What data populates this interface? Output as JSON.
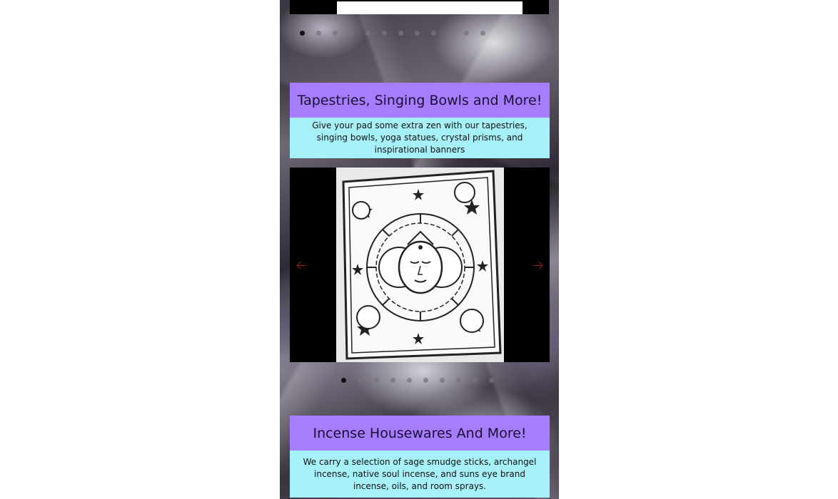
{
  "sections": [
    {
      "title": "Tapestries, Singing Bowls and More!",
      "description": "Give your pad some extra zen with our tapestries, singing bowls, yoga statues, crystal prisms, and inspirational banners"
    },
    {
      "title": "Incense Housewares And More!",
      "description": "We carry a selection of sage smudge sticks, archangel incense, native soul incense, and suns eye brand incense, oils, and room sprays."
    }
  ],
  "carousel": {
    "prev_icon": "arrow-left-icon",
    "next_icon": "arrow-right-icon",
    "image": "sun-moon-tapestry",
    "arrow_color": "#9b1b1b"
  },
  "colors": {
    "title_bg": "#a77dff",
    "desc_bg": "#a6f0f9"
  }
}
